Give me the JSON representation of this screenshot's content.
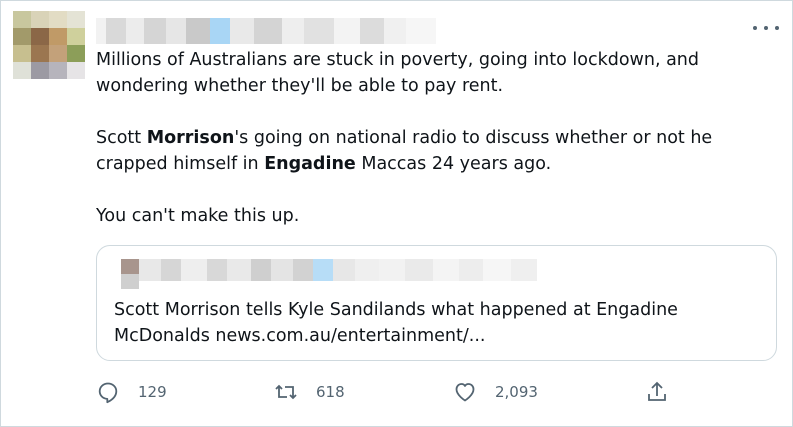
{
  "tweet": {
    "text_line1": "Millions of Australians are stuck in poverty, going into lockdown, and",
    "text_line2": "wondering whether they'll be able to pay rent.",
    "p2_a": "Scott ",
    "p2_bold1": "Morrison",
    "p2_b": "'s going on national radio to discuss whether or not he",
    "p2_c": "crapped himself in ",
    "p2_bold2": "Engadine",
    "p2_d": " Maccas 24 years ago.",
    "p3": "You can't make this up."
  },
  "quote": {
    "line1": "Scott Morrison tells Kyle Sandilands what happened at Engadine",
    "line2": "McDonalds news.com.au/entertainment/..."
  },
  "actions": {
    "reply_count": "129",
    "retweet_count": "618",
    "like_count": "2,093"
  },
  "icons": {
    "reply": "reply-icon",
    "retweet": "retweet-icon",
    "like": "heart-icon",
    "share": "share-icon",
    "more": "more-icon"
  },
  "colors": {
    "text": "#0f1419",
    "muted": "#536471",
    "border": "#cfd9de"
  }
}
